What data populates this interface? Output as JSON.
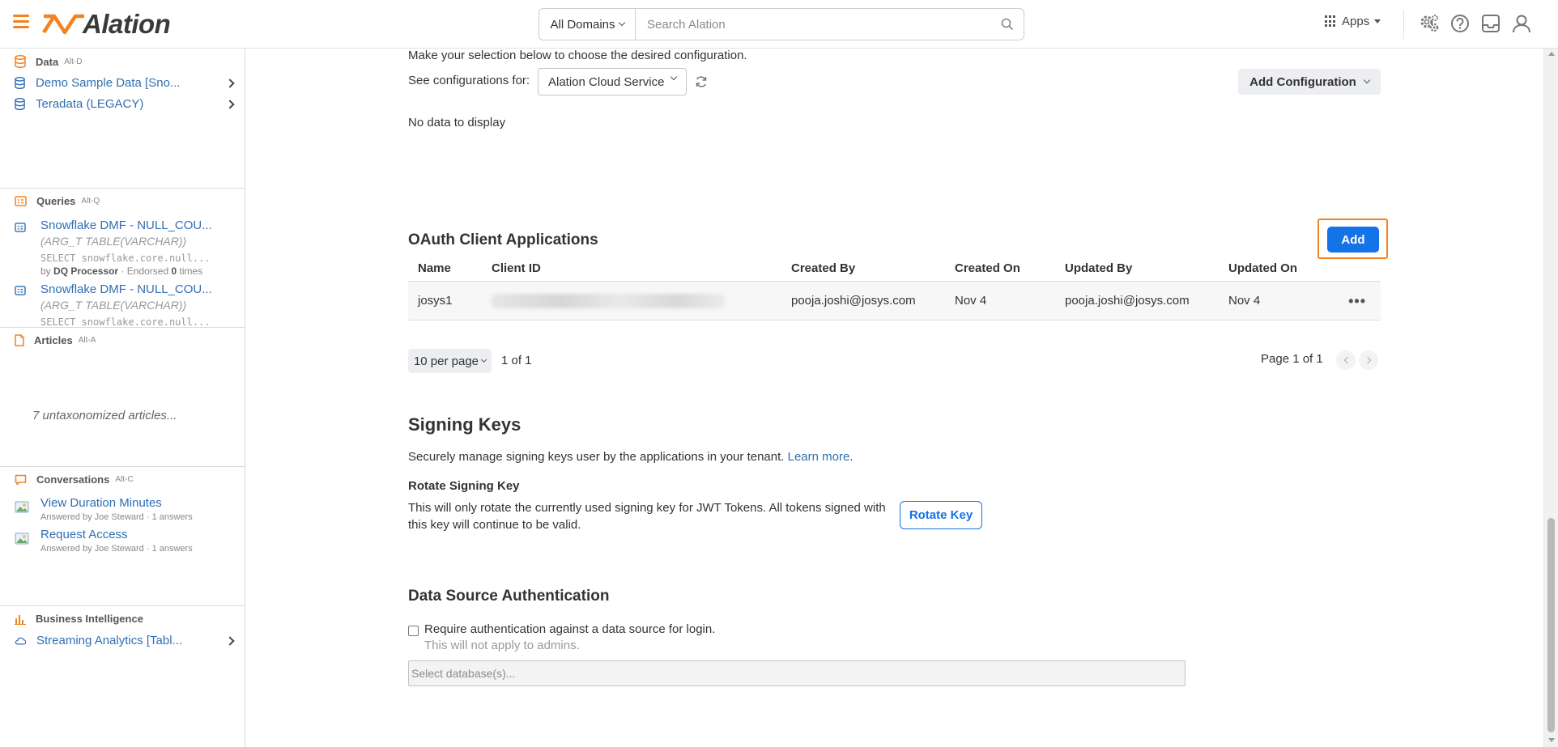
{
  "colors": {
    "brand_orange": "#f58220",
    "link_blue": "#2f6fb3",
    "primary_blue": "#1473e6"
  },
  "header": {
    "logo_text": "Alation",
    "domain_select": "All Domains",
    "search_placeholder": "Search Alation",
    "apps_label": "Apps",
    "icons": [
      "admin-settings-icon",
      "help-icon",
      "inbox-icon",
      "user-icon"
    ]
  },
  "sidebar": {
    "data": {
      "title": "Data",
      "shortcut": "Alt-D",
      "items": [
        {
          "label": "Demo Sample Data [Sno...",
          "icon": "database-icon"
        },
        {
          "label": "Teradata (LEGACY)",
          "icon": "database-icon"
        }
      ]
    },
    "queries": {
      "title": "Queries",
      "shortcut": "Alt-Q",
      "items": [
        {
          "title": "Snowflake DMF - NULL_COU...",
          "subtitle": "(ARG_T TABLE(VARCHAR))",
          "code": "SELECT snowflake.core.null...",
          "meta_by": "by",
          "meta_author": "DQ Processor",
          "meta_endorsed": "· Endorsed",
          "meta_count": "0",
          "meta_times": "times"
        },
        {
          "title": "Snowflake DMF - NULL_COU...",
          "subtitle": "(ARG_T TABLE(VARCHAR))",
          "code": "SELECT snowflake.core.null..."
        }
      ]
    },
    "articles": {
      "title": "Articles",
      "shortcut": "Alt-A",
      "empty": "7 untaxonomized articles..."
    },
    "conversations": {
      "title": "Conversations",
      "shortcut": "Alt-C",
      "items": [
        {
          "title": "View Duration Minutes",
          "meta": "Answered by Joe Steward · 1 answers"
        },
        {
          "title": "Request Access",
          "meta": "Answered by Joe Steward · 1 answers"
        }
      ]
    },
    "bi": {
      "title": "Business Intelligence",
      "items": [
        {
          "label": "Streaming Analytics [Tabl...",
          "icon": "cloud-icon"
        }
      ]
    }
  },
  "main": {
    "intro": "Make your selection below to choose the desired configuration.",
    "see_configs_label": "See configurations for:",
    "config_select": "Alation Cloud Service",
    "add_configuration": "Add Configuration",
    "no_data": "No data to display",
    "oauth": {
      "title": "OAuth Client Applications",
      "add_button": "Add",
      "columns": [
        "Name",
        "Client ID",
        "Created By",
        "Created On",
        "Updated By",
        "Updated On"
      ],
      "rows": [
        {
          "name": "josys1",
          "client_id": "",
          "created_by": "pooja.joshi@josys.com",
          "created_on": "Nov 4",
          "updated_by": "pooja.joshi@josys.com",
          "updated_on": "Nov 4"
        }
      ],
      "per_page": "10 per page",
      "count": "1 of 1",
      "page": "Page 1 of 1"
    },
    "signing_keys": {
      "title": "Signing Keys",
      "description": "Securely manage signing keys user by the applications in your tenant.",
      "learn_more": "Learn more",
      "period": ".",
      "rotate_title": "Rotate Signing Key",
      "rotate_desc": "This will only rotate the currently used signing key for JWT Tokens. All tokens signed with this key will continue to be valid.",
      "rotate_button": "Rotate Key"
    },
    "dsa": {
      "title": "Data Source Authentication",
      "checkbox_label": "Require authentication against a data source for login.",
      "checked": false,
      "note": "This will not apply to admins.",
      "db_placeholder": "Select database(s)..."
    }
  }
}
